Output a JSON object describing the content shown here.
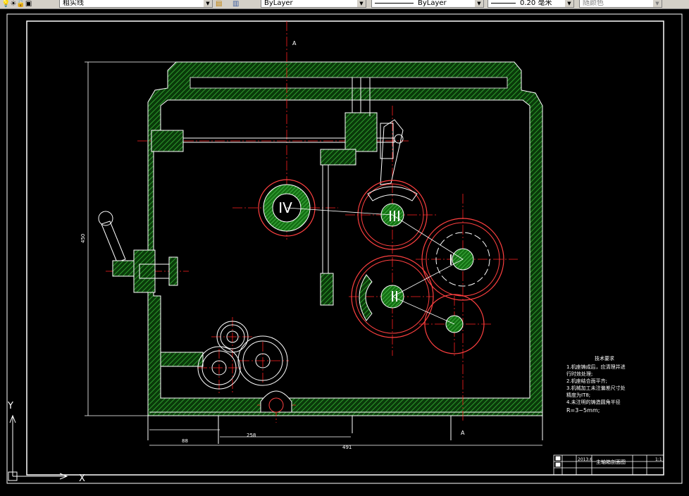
{
  "toolbar": {
    "layer_name": "粗实线",
    "color": "ByLayer",
    "linetype": "ByLayer",
    "lineweight": "0.20",
    "lineweight_unit": "毫米",
    "plot_style": "随颜色"
  },
  "drawing": {
    "section_label_top": "A",
    "section_label_bottom": "A",
    "shaft_labels": [
      "IV",
      "III",
      "I",
      "II"
    ],
    "dim_height": "450",
    "dim_88": "88",
    "dim_258": "258",
    "dim_491": "491",
    "tech_requirements": {
      "title": "技术要求",
      "lines": [
        "1.机座铸成后，应清理并进",
        "行时效处理;",
        "2.机座结合面平齐;",
        "3.机械加工未注偏差尺寸处",
        "精度为IT8;",
        "4.未注明的铸造圆角半径",
        "R=3~5mm;"
      ]
    },
    "title_block": {
      "date": "2013.6",
      "name": "主轴箱剖面图",
      "scale": "1:1"
    },
    "ucs": {
      "y": "Y",
      "x": "X"
    }
  },
  "colors": {
    "background": "#000000",
    "outline": "#ffffff",
    "hatch": "#2e8b2e",
    "centerline": "#ff2020",
    "gear": "#ff4040"
  }
}
